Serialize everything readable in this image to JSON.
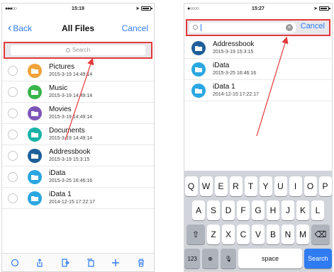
{
  "screenA": {
    "status": {
      "signal": "●●●○○",
      "time": "15:19"
    },
    "nav": {
      "back": "Back",
      "title": "All Files",
      "cancel": "Cancel"
    },
    "search": {
      "placeholder": "Search"
    },
    "files": [
      {
        "name": "Pictures",
        "date": "2015-3-19 14:49:14",
        "icon": "pictures-folder-icon",
        "color": "#f1a33a"
      },
      {
        "name": "Music",
        "date": "2015-3-19 14:49:14",
        "icon": "music-folder-icon",
        "color": "#39b54a"
      },
      {
        "name": "Movies",
        "date": "2015-3-19 14:49:14",
        "icon": "movies-folder-icon",
        "color": "#7d56b8"
      },
      {
        "name": "Documents",
        "date": "2015-3-19 14:49:14",
        "icon": "documents-folder-icon",
        "color": "#17b3a6"
      },
      {
        "name": "Addressbook",
        "date": "2015-3-19 15:3:15",
        "icon": "addressbook-icon",
        "color": "#1e5f9a"
      },
      {
        "name": "iData",
        "date": "2015-3-25 16:46:16",
        "icon": "folder-icon",
        "color": "#2aa7e1"
      },
      {
        "name": "iData 1",
        "date": "2014-12-15 17:22:17",
        "icon": "folder-icon",
        "color": "#2aa7e1"
      }
    ],
    "toolbar": [
      "refresh-icon",
      "share-icon",
      "export-icon",
      "copy-icon",
      "add-icon",
      "trash-icon"
    ]
  },
  "screenB": {
    "status": {
      "signal": "●○○○○",
      "time": "15:27"
    },
    "search": {
      "query": "",
      "cancel": "Cancel"
    },
    "files": [
      {
        "name": "Addressbook",
        "date": "2015-3-19 15:3:15",
        "icon": "addressbook-icon",
        "color": "#1e5f9a"
      },
      {
        "name": "iData",
        "date": "2015-3-25 16:46:16",
        "icon": "folder-icon",
        "color": "#2aa7e1"
      },
      {
        "name": "iData 1",
        "date": "2014-12-15 17:22:17",
        "icon": "folder-icon",
        "color": "#2aa7e1"
      }
    ],
    "keyboard": {
      "row1": [
        "Q",
        "W",
        "E",
        "R",
        "T",
        "Y",
        "U",
        "I",
        "O",
        "P"
      ],
      "row2": [
        "A",
        "S",
        "D",
        "F",
        "G",
        "H",
        "J",
        "K",
        "L"
      ],
      "row3": [
        "Z",
        "X",
        "C",
        "V",
        "B",
        "N",
        "M"
      ],
      "numbers_key": "123",
      "space_key": "space",
      "search_key": "Search"
    }
  },
  "colors": {
    "accent": "#2f7bf2",
    "highlight": "#e2393a"
  }
}
